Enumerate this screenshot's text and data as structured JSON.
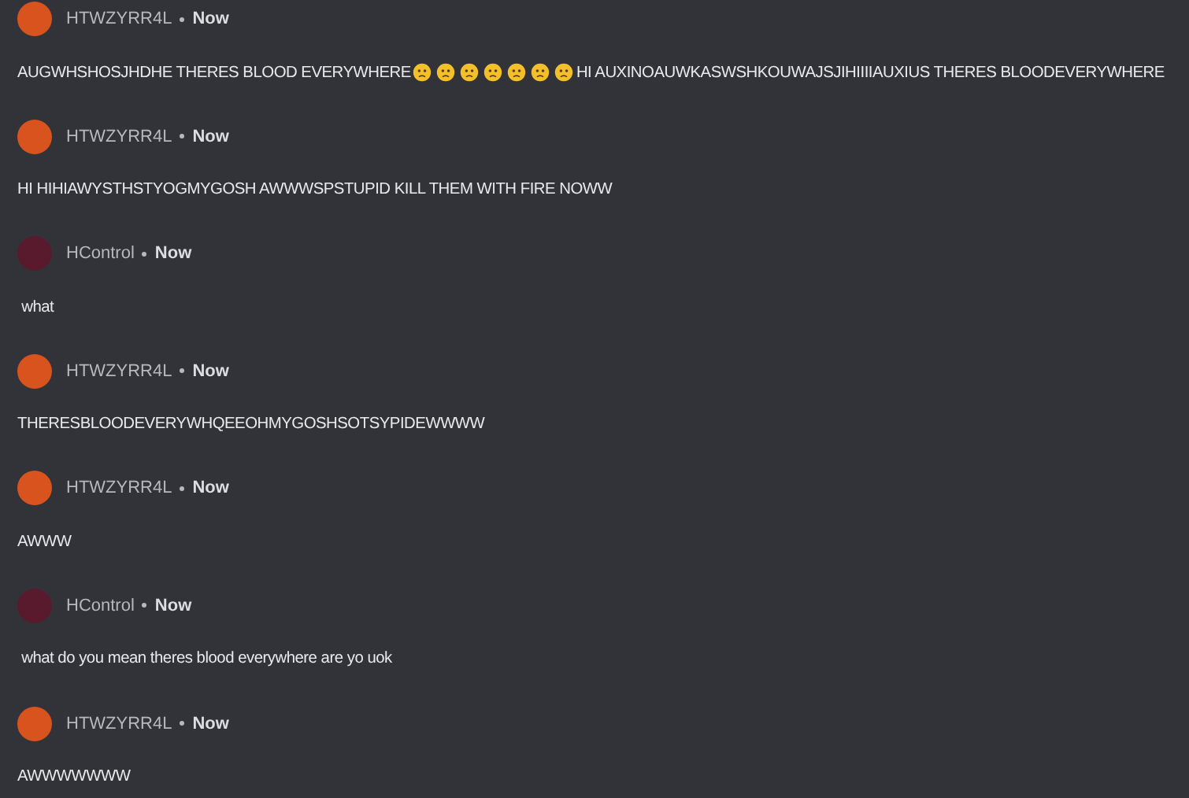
{
  "messages": [
    {
      "author": "HTWZYRR4L",
      "color": "#d9531e",
      "time": "Now",
      "parts": [
        {
          "kind": "text",
          "text": "AUGWHSHOSJHDHE THERES BLOOD EVERYWHERE"
        },
        {
          "kind": "emoji"
        },
        {
          "kind": "emoji"
        },
        {
          "kind": "emoji"
        },
        {
          "kind": "emoji"
        },
        {
          "kind": "emoji"
        },
        {
          "kind": "emoji"
        },
        {
          "kind": "emoji"
        },
        {
          "kind": "text",
          "text": "HI AUXINOAUWKASWSHKOUWAJSJIHIIIIAUXIUS THERES BLOODEVERYWHERE"
        }
      ]
    },
    {
      "author": "HTWZYRR4L",
      "color": "#d9531e",
      "time": "Now",
      "parts": [
        {
          "kind": "text",
          "text": "HI HIHIAWYSTHSTYOGMYGOSH AWWWSPSTUPID KILL THEM WITH FIRE NOWW"
        }
      ]
    },
    {
      "author": "HControl",
      "color": "#5a1a2e",
      "time": "Now",
      "parts": [
        {
          "kind": "text",
          "text": " what"
        }
      ]
    },
    {
      "author": "HTWZYRR4L",
      "color": "#d9531e",
      "time": "Now",
      "parts": [
        {
          "kind": "text",
          "text": "THERESBLOODEVERYWHQEEOHMYGOSHSOTSYPIDEWWWW"
        }
      ]
    },
    {
      "author": "HTWZYRR4L",
      "color": "#d9531e",
      "time": "Now",
      "parts": [
        {
          "kind": "text",
          "text": "AWWW"
        }
      ]
    },
    {
      "author": "HControl",
      "color": "#5a1a2e",
      "time": "Now",
      "parts": [
        {
          "kind": "text",
          "text": " what do you mean theres blood everywhere are yo uok"
        }
      ]
    },
    {
      "author": "HTWZYRR4L",
      "color": "#d9531e",
      "time": "Now",
      "parts": [
        {
          "kind": "text",
          "text": "AWWWWWWW"
        }
      ]
    }
  ]
}
